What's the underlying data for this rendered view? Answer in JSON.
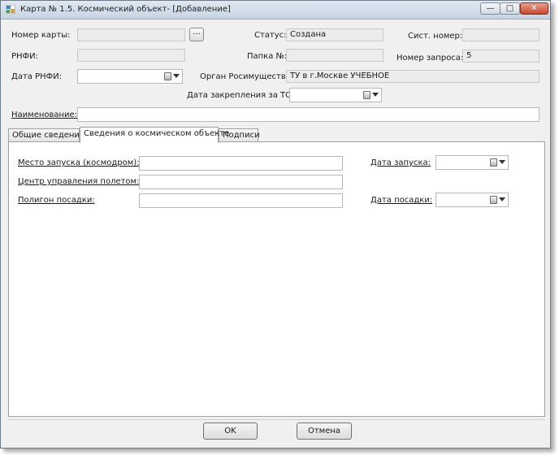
{
  "window": {
    "title": "Карта № 1.5. Космический объект- [Добавление]",
    "controls": {
      "minimize": "—",
      "maximize": "□",
      "close": "✕"
    }
  },
  "header": {
    "card_number_label": "Номер карты:",
    "card_number_value": "",
    "browse_button_label": "...",
    "status_label": "Статус:",
    "status_value": "Создана",
    "sys_number_label": "Сист. номер:",
    "sys_number_value": "",
    "rnfi_label": "РНФИ:",
    "rnfi_value": "",
    "folder_label": "Папка №:",
    "folder_value": "",
    "request_number_label": "Номер запроса:",
    "request_number_value": "5",
    "rnfi_date_label": "Дата РНФИ:",
    "rnfi_date_value": "",
    "property_body_label": "Орган Росимущества:",
    "property_body_value": "ТУ в г.Москве УЧЕБНОЕ",
    "assignment_date_label": "Дата закрепления за ТО:",
    "assignment_date_value": "",
    "name_label": "Наименование:",
    "name_value": ""
  },
  "tabs": [
    {
      "label": "Общие сведения"
    },
    {
      "label": "Сведения о космическом объекте"
    },
    {
      "label": "Подписи"
    }
  ],
  "space_object": {
    "launch_site_label": "Место запуска (космодром):",
    "launch_site_value": "",
    "flight_control_label": "Центр управления полетом:",
    "flight_control_value": "",
    "landing_site_label": "Полигон посадки:",
    "landing_site_value": "",
    "launch_date_label": "Дата запуска:",
    "launch_date_value": "",
    "landing_date_label": "Дата посадки:",
    "landing_date_value": ""
  },
  "footer": {
    "ok_label": "OK",
    "cancel_label": "Отмена"
  }
}
